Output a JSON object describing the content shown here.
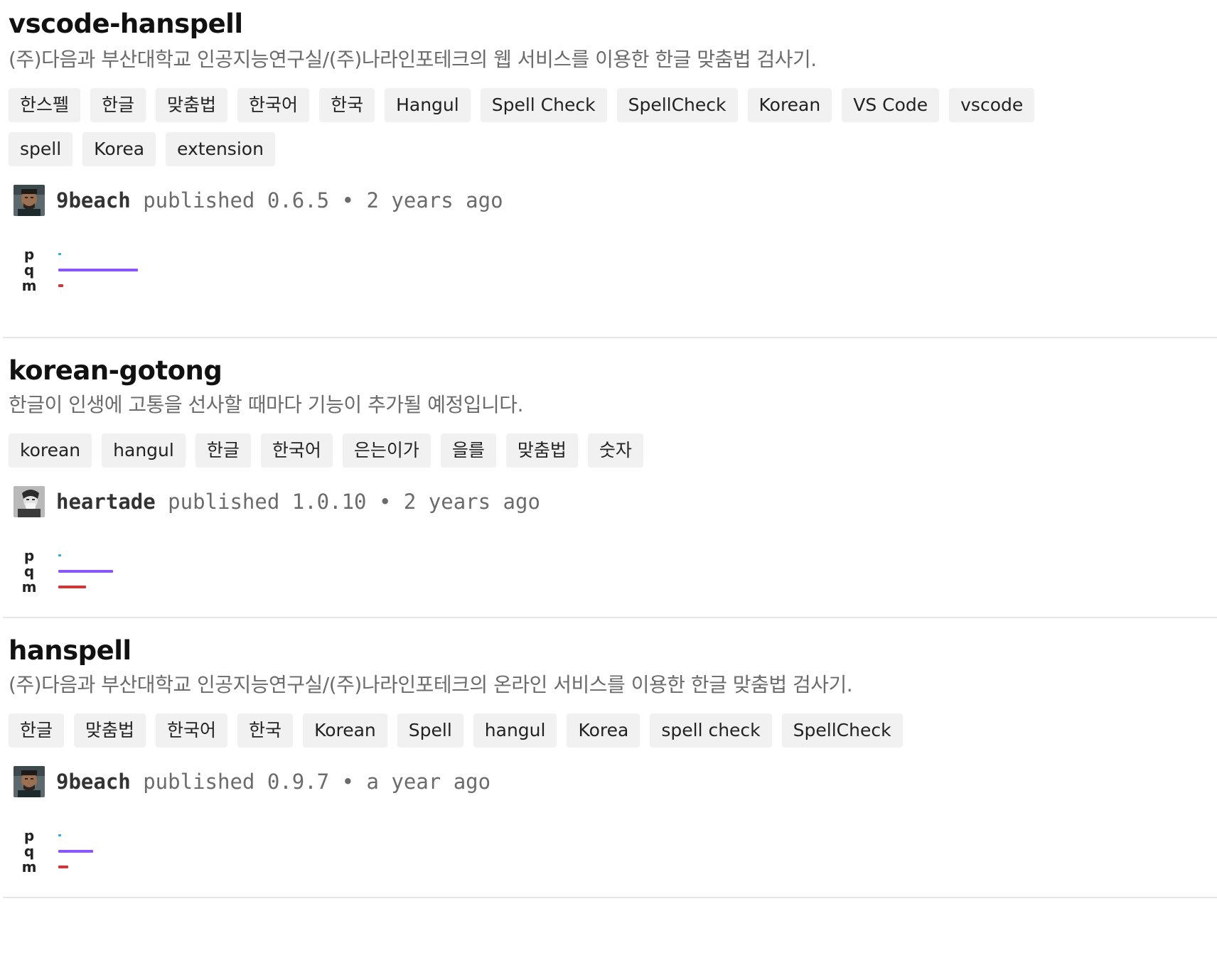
{
  "packages": [
    {
      "name": "vscode-hanspell",
      "description": "(주)다음과 부산대학교 인공지능연구실/(주)나라인포테크의 웹 서비스를 이용한 한글 맞춤법 검사기.",
      "keywords": [
        "한스펠",
        "한글",
        "맞춤법",
        "한국어",
        "한국",
        "Hangul",
        "Spell Check",
        "SpellCheck",
        "Korean",
        "VS Code",
        "vscode",
        "spell",
        "Korea",
        "extension"
      ],
      "publisher": "9beach",
      "published_text": " published 0.6.5 • 2 years ago",
      "scores": {
        "p": {
          "label": "p",
          "value": 0.01,
          "color": "#29abe2"
        },
        "q": {
          "label": "q",
          "value": 0.32,
          "color": "#8956ff"
        },
        "m": {
          "label": "m",
          "value": 0.02,
          "color": "#cb3837"
        }
      }
    },
    {
      "name": "korean-gotong",
      "description": "한글이 인생에 고통을 선사할 때마다 기능이 추가될 예정입니다.",
      "keywords": [
        "korean",
        "hangul",
        "한글",
        "한국어",
        "은는이가",
        "을를",
        "맞춤법",
        "숫자"
      ],
      "publisher": "heartade",
      "published_text": " published 1.0.10 • 2 years ago",
      "scores": {
        "p": {
          "label": "p",
          "value": 0.01,
          "color": "#29abe2"
        },
        "q": {
          "label": "q",
          "value": 0.22,
          "color": "#8956ff"
        },
        "m": {
          "label": "m",
          "value": 0.11,
          "color": "#cb3837"
        }
      }
    },
    {
      "name": "hanspell",
      "description": "(주)다음과 부산대학교 인공지능연구실/(주)나라인포테크의 온라인 서비스를 이용한 한글 맞춤법 검사기.",
      "keywords": [
        "한글",
        "맞춤법",
        "한국어",
        "한국",
        "Korean",
        "Spell",
        "hangul",
        "Korea",
        "spell check",
        "SpellCheck"
      ],
      "publisher": "9beach",
      "published_text": " published 0.9.7 • a year ago",
      "scores": {
        "p": {
          "label": "p",
          "value": 0.01,
          "color": "#29abe2"
        },
        "q": {
          "label": "q",
          "value": 0.14,
          "color": "#8956ff"
        },
        "m": {
          "label": "m",
          "value": 0.04,
          "color": "#cb3837"
        }
      }
    }
  ]
}
